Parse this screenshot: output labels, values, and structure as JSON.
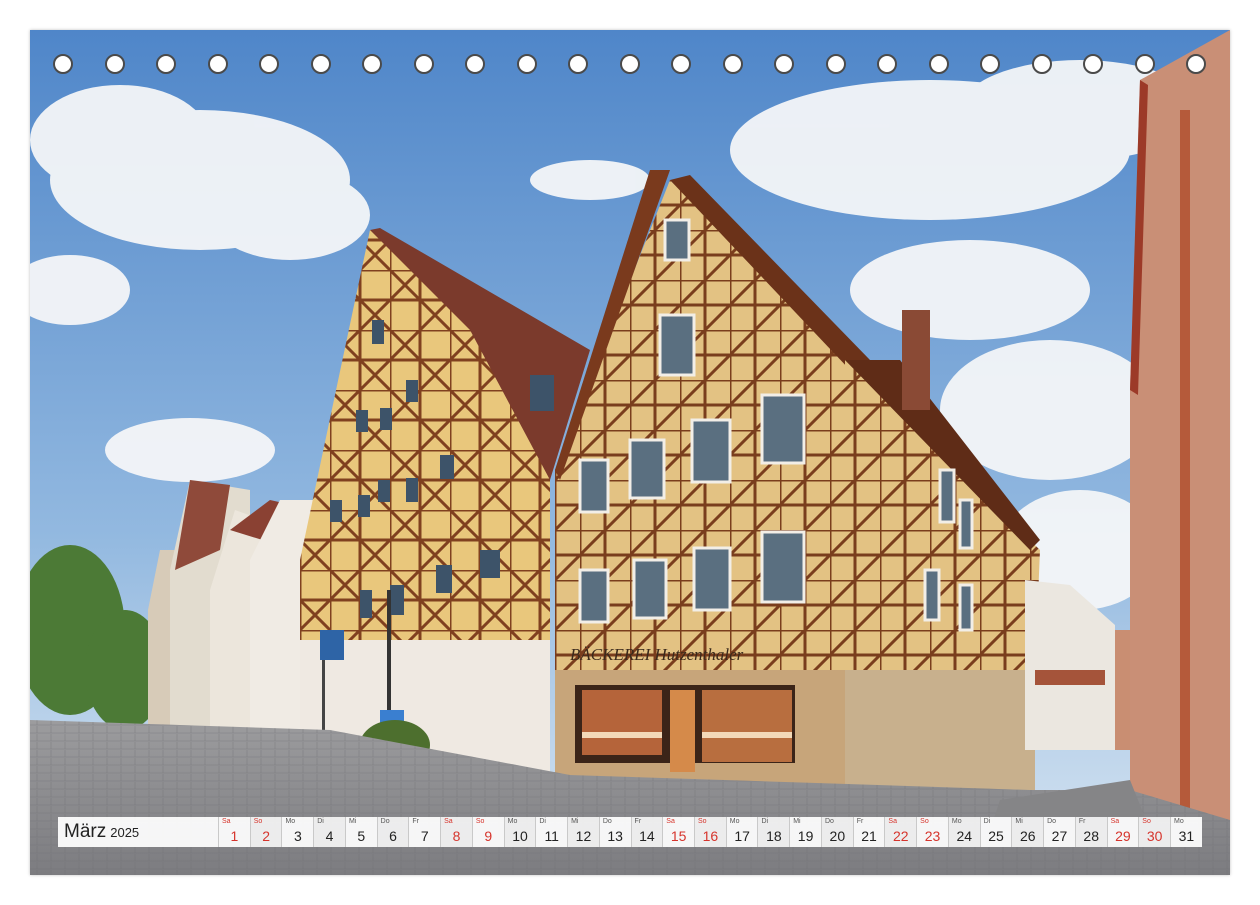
{
  "calendar": {
    "month": "März",
    "year": "2025",
    "days": [
      {
        "wd": "Sa",
        "n": "1",
        "we": true
      },
      {
        "wd": "So",
        "n": "2",
        "we": true
      },
      {
        "wd": "Mo",
        "n": "3",
        "we": false
      },
      {
        "wd": "Di",
        "n": "4",
        "we": false
      },
      {
        "wd": "Mi",
        "n": "5",
        "we": false
      },
      {
        "wd": "Do",
        "n": "6",
        "we": false
      },
      {
        "wd": "Fr",
        "n": "7",
        "we": false
      },
      {
        "wd": "Sa",
        "n": "8",
        "we": true
      },
      {
        "wd": "So",
        "n": "9",
        "we": true
      },
      {
        "wd": "Mo",
        "n": "10",
        "we": false
      },
      {
        "wd": "Di",
        "n": "11",
        "we": false
      },
      {
        "wd": "Mi",
        "n": "12",
        "we": false
      },
      {
        "wd": "Do",
        "n": "13",
        "we": false
      },
      {
        "wd": "Fr",
        "n": "14",
        "we": false
      },
      {
        "wd": "Sa",
        "n": "15",
        "we": true
      },
      {
        "wd": "So",
        "n": "16",
        "we": true
      },
      {
        "wd": "Mo",
        "n": "17",
        "we": false
      },
      {
        "wd": "Di",
        "n": "18",
        "we": false
      },
      {
        "wd": "Mi",
        "n": "19",
        "we": false
      },
      {
        "wd": "Do",
        "n": "20",
        "we": false
      },
      {
        "wd": "Fr",
        "n": "21",
        "we": false
      },
      {
        "wd": "Sa",
        "n": "22",
        "we": true
      },
      {
        "wd": "So",
        "n": "23",
        "we": true
      },
      {
        "wd": "Mo",
        "n": "24",
        "we": false
      },
      {
        "wd": "Di",
        "n": "25",
        "we": false
      },
      {
        "wd": "Mi",
        "n": "26",
        "we": false
      },
      {
        "wd": "Do",
        "n": "27",
        "we": false
      },
      {
        "wd": "Fr",
        "n": "28",
        "we": false
      },
      {
        "wd": "Sa",
        "n": "29",
        "we": true
      },
      {
        "wd": "So",
        "n": "30",
        "we": true
      },
      {
        "wd": "Mo",
        "n": "31",
        "we": false
      }
    ]
  },
  "photo": {
    "shop_sign": "BÄCKEREI Hutzenthaler"
  },
  "colors": {
    "weekend": "#d6342c",
    "sky": "#6f9fd4",
    "timber": "#7a3b1c",
    "plaster": "#e8c77e"
  }
}
